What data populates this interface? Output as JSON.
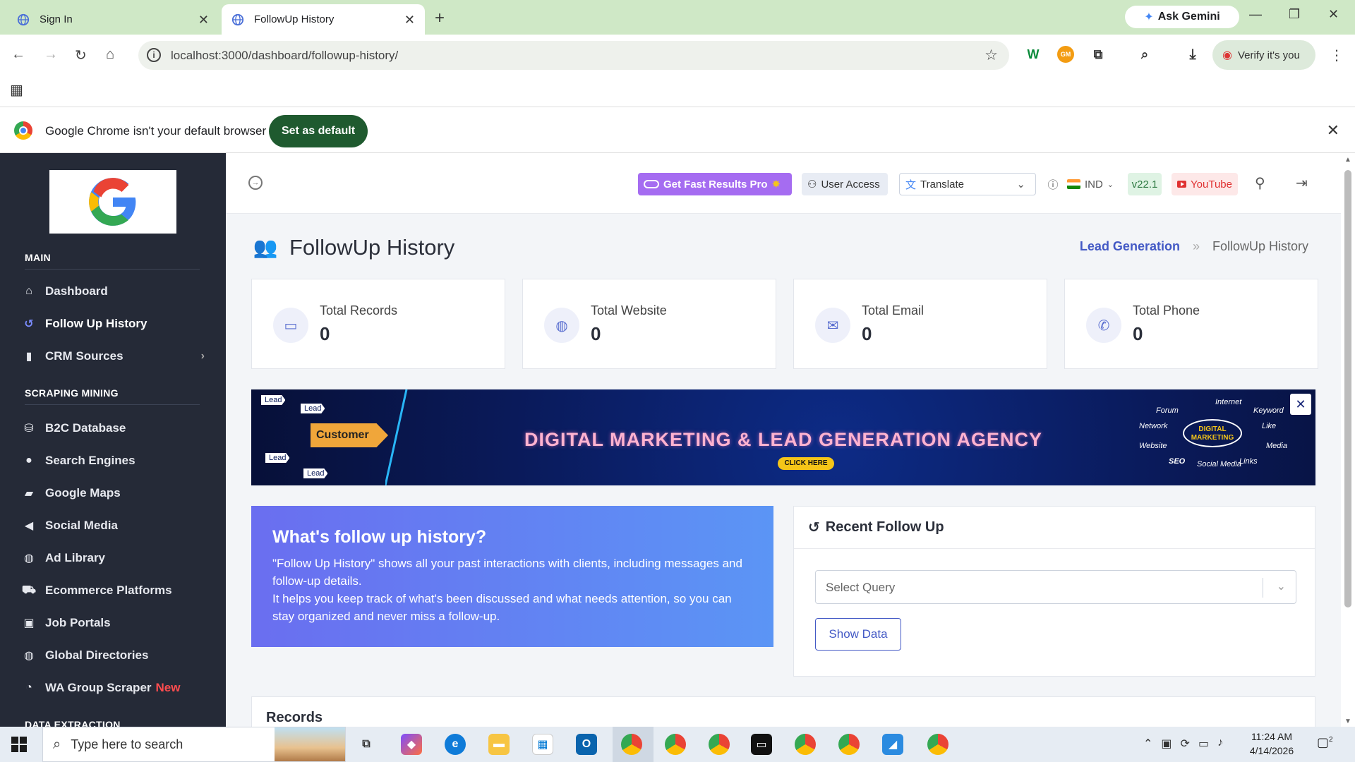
{
  "browser": {
    "tabs": [
      {
        "title": "Sign In"
      },
      {
        "title": "FollowUp History"
      }
    ],
    "ask_gemini": "Ask Gemini",
    "url": "localhost:3000/dashboard/followup-history/",
    "verify_label": "Verify it's you",
    "ext_gm": "GM",
    "default_bar": {
      "message": "Google Chrome isn't your default browser",
      "button": "Set as default"
    }
  },
  "sidebar": {
    "sections": [
      {
        "title": "MAIN"
      },
      {
        "title": "SCRAPING MINING"
      },
      {
        "title": "DATA EXTRACTION"
      }
    ],
    "main_items": [
      {
        "label": "Dashboard",
        "icon": "home-icon"
      },
      {
        "label": "Follow Up History",
        "icon": "history-icon"
      },
      {
        "label": "CRM Sources",
        "icon": "bar-chart-icon"
      }
    ],
    "scraping_items": [
      {
        "label": "B2C Database",
        "icon": "database-icon"
      },
      {
        "label": "Search Engines",
        "icon": "search-icon"
      },
      {
        "label": "Google Maps",
        "icon": "map-icon"
      },
      {
        "label": "Social Media",
        "icon": "megaphone-icon"
      },
      {
        "label": "Ad Library",
        "icon": "globe-icon"
      },
      {
        "label": "Ecommerce Platforms",
        "icon": "cart-icon"
      },
      {
        "label": "Job Portals",
        "icon": "briefcase-icon"
      },
      {
        "label": "Global Directories",
        "icon": "globe-icon"
      },
      {
        "label": "WA Group Scraper",
        "icon": "whatsapp-icon",
        "badge": "New"
      }
    ]
  },
  "topnav": {
    "pro_label": "Get Fast Results Pro",
    "user_access": "User Access",
    "translate": "Translate",
    "country": "IND",
    "version": "v22.1",
    "youtube": "YouTube"
  },
  "page": {
    "title": "FollowUp History",
    "breadcrumb": [
      "Lead Generation",
      "FollowUp History"
    ]
  },
  "stats": [
    {
      "label": "Total Records",
      "value": "0",
      "icon": "clipboard-icon"
    },
    {
      "label": "Total Website",
      "value": "0",
      "icon": "globe-icon"
    },
    {
      "label": "Total Email",
      "value": "0",
      "icon": "mail-icon"
    },
    {
      "label": "Total Phone",
      "value": "0",
      "icon": "phone-icon"
    }
  ],
  "banner": {
    "headline": "DIGITAL MARKETING & LEAD GENERATION AGENCY",
    "cta": "CLICK HERE",
    "customer": "Customer",
    "lead_word": "Lead",
    "dm_badge": "DIGITAL MARKETING",
    "words": [
      "Internet",
      "Keyword",
      "Forum",
      "Network",
      "Like",
      "Website",
      "Media",
      "SEO",
      "Social Media",
      "Links"
    ]
  },
  "info": {
    "title": "What's follow up history?",
    "p1": "\"Follow Up History\" shows all your past interactions with clients, including messages and follow-up details.",
    "p2": "It helps you keep track of what's been discussed and what needs attention, so you can stay organized and never miss a follow-up."
  },
  "recent": {
    "title": "Recent Follow Up",
    "select_placeholder": "Select Query",
    "button": "Show Data"
  },
  "records": {
    "title": "Records"
  },
  "taskbar": {
    "search_placeholder": "Type here to search",
    "time": "11:24 AM",
    "date": "4/14/2026",
    "notifications": "2"
  },
  "colors": {
    "sidebar_bg": "#252a37",
    "accent": "#4359c5",
    "pro_purple": "#a56cf1",
    "set_default_green": "#1f5a2f"
  }
}
